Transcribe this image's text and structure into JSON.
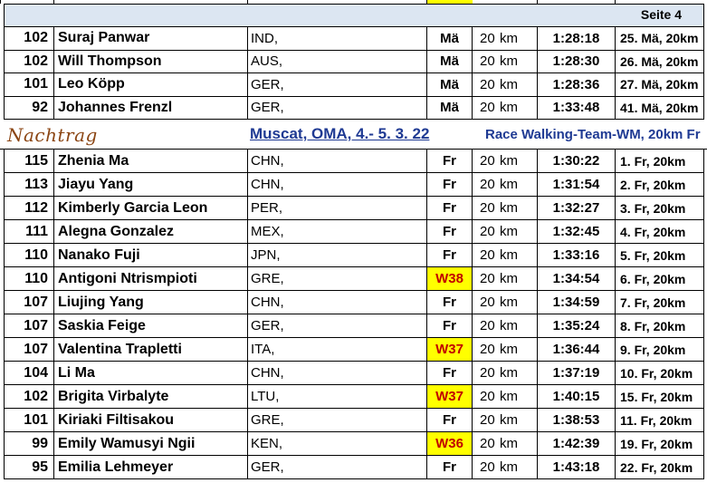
{
  "page_label": "Seite 4",
  "colors": {
    "header_band": "#dce6f2",
    "highlight": "#ffff00",
    "highlight_text": "#c00000",
    "event_text": "#1f3a93",
    "nachtrag_text": "#8b4513"
  },
  "rows_top": [
    {
      "num": "102",
      "name": "Suraj Panwar",
      "country": "IND,",
      "cat": "Mä",
      "hl": false,
      "dist": "20",
      "unit": "km",
      "time": "1:28:18",
      "rank": "25. Mä, 20km"
    },
    {
      "num": "102",
      "name": "Will Thompson",
      "country": "AUS,",
      "cat": "Mä",
      "hl": false,
      "dist": "20",
      "unit": "km",
      "time": "1:28:30",
      "rank": "26. Mä, 20km"
    },
    {
      "num": "101",
      "name": "Leo Köpp",
      "country": "GER,",
      "cat": "Mä",
      "hl": false,
      "dist": "20",
      "unit": "km",
      "time": "1:28:36",
      "rank": "27. Mä, 20km"
    },
    {
      "num": "92",
      "name": "Johannes Frenzl",
      "country": "GER,",
      "cat": "Mä",
      "hl": false,
      "dist": "20",
      "unit": "km",
      "time": "1:33:48",
      "rank": "41. Mä, 20km"
    }
  ],
  "nachtrag": {
    "label": "Nachtrag",
    "event": "Muscat, OMA, 4.- 5. 3. 22",
    "competition": "Race Walking-Team-WM, 20km Fr"
  },
  "rows_bottom": [
    {
      "num": "115",
      "name": "Zhenia Ma",
      "country": "CHN,",
      "cat": "Fr",
      "hl": false,
      "dist": "20",
      "unit": "km",
      "time": "1:30:22",
      "rank": "1. Fr, 20km"
    },
    {
      "num": "113",
      "name": "Jiayu Yang",
      "country": "CHN,",
      "cat": "Fr",
      "hl": false,
      "dist": "20",
      "unit": "km",
      "time": "1:31:54",
      "rank": "2. Fr, 20km"
    },
    {
      "num": "112",
      "name": "Kimberly Garcia Leon",
      "country": "PER,",
      "cat": "Fr",
      "hl": false,
      "dist": "20",
      "unit": "km",
      "time": "1:32:27",
      "rank": "3. Fr, 20km"
    },
    {
      "num": "111",
      "name": "Alegna Gonzalez",
      "country": "MEX,",
      "cat": "Fr",
      "hl": false,
      "dist": "20",
      "unit": "km",
      "time": "1:32:45",
      "rank": "4. Fr, 20km"
    },
    {
      "num": "110",
      "name": "Nanako Fuji",
      "country": "JPN,",
      "cat": "Fr",
      "hl": false,
      "dist": "20",
      "unit": "km",
      "time": "1:33:16",
      "rank": "5. Fr, 20km"
    },
    {
      "num": "110",
      "name": "Antigoni Ntrismpioti",
      "country": "GRE,",
      "cat": "W38",
      "hl": true,
      "dist": "20",
      "unit": "km",
      "time": "1:34:54",
      "rank": "6. Fr, 20km"
    },
    {
      "num": "107",
      "name": "Liujing Yang",
      "country": "CHN,",
      "cat": "Fr",
      "hl": false,
      "dist": "20",
      "unit": "km",
      "time": "1:34:59",
      "rank": "7. Fr, 20km"
    },
    {
      "num": "107",
      "name": "Saskia Feige",
      "country": "GER,",
      "cat": "Fr",
      "hl": false,
      "dist": "20",
      "unit": "km",
      "time": "1:35:24",
      "rank": "8. Fr, 20km"
    },
    {
      "num": "107",
      "name": "Valentina Trapletti",
      "country": "ITA,",
      "cat": "W37",
      "hl": true,
      "dist": "20",
      "unit": "km",
      "time": "1:36:44",
      "rank": "9. Fr, 20km"
    },
    {
      "num": "104",
      "name": "Li Ma",
      "country": "CHN,",
      "cat": "Fr",
      "hl": false,
      "dist": "20",
      "unit": "km",
      "time": "1:37:19",
      "rank": "10. Fr, 20km"
    },
    {
      "num": "102",
      "name": "Brigita Virbalyte",
      "country": "LTU,",
      "cat": "W37",
      "hl": true,
      "dist": "20",
      "unit": "km",
      "time": "1:40:15",
      "rank": "15. Fr, 20km"
    },
    {
      "num": "101",
      "name": "Kiriaki Filtisakou",
      "country": "GRE,",
      "cat": "Fr",
      "hl": false,
      "dist": "20",
      "unit": "km",
      "time": "1:38:53",
      "rank": "11. Fr, 20km"
    },
    {
      "num": "99",
      "name": "Emily Wamusyi Ngii",
      "country": "KEN,",
      "cat": "W36",
      "hl": true,
      "dist": "20",
      "unit": "km",
      "time": "1:42:39",
      "rank": "19. Fr, 20km"
    },
    {
      "num": "95",
      "name": "Emilia Lehmeyer",
      "country": "GER,",
      "cat": "Fr",
      "hl": false,
      "dist": "20",
      "unit": "km",
      "time": "1:43:18",
      "rank": "22. Fr, 20km"
    }
  ]
}
